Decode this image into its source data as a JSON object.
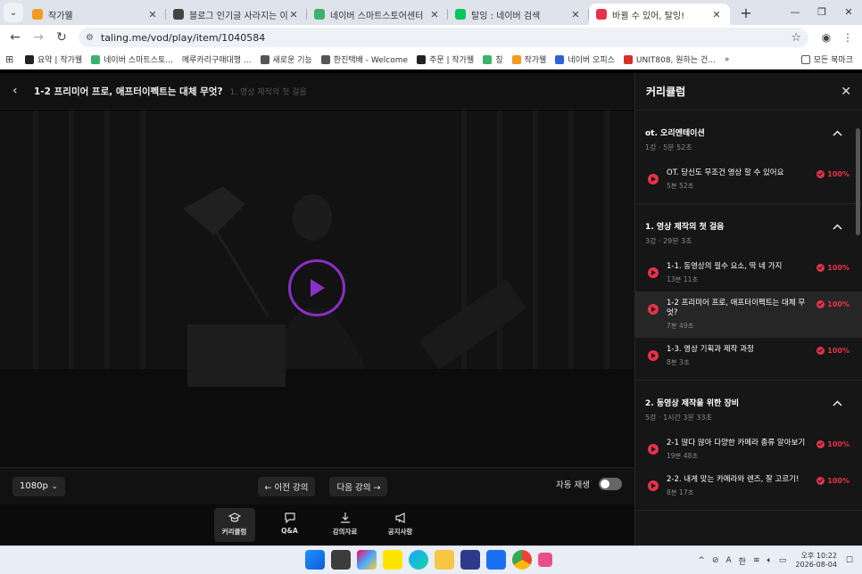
{
  "browser": {
    "tabs": [
      {
        "title": "작가웰",
        "color": "#f39a1f",
        "icon": "flame-icon"
      },
      {
        "title": "블로그 인기글 사라지는 이유",
        "color": "#444444",
        "icon": "openai-icon"
      },
      {
        "title": "네이버 스마트스토어센터",
        "color": "#3bb36c",
        "icon": "smartstore-icon"
      },
      {
        "title": "탈잉 : 네이버 검색",
        "color": "#03c75a",
        "icon": "naver-icon"
      },
      {
        "title": "바뀔 수 있어, 탈잉!",
        "color": "#e8324a",
        "icon": "taling-icon",
        "active": true
      }
    ],
    "url": "taling.me/vod/play/item/1040584",
    "bookmarks": [
      {
        "label": "요약 | 작가웰",
        "color": "#222222"
      },
      {
        "label": "네이버 스마트스토...",
        "color": "#3bb36c"
      },
      {
        "label": "메루카리구매대행 ...",
        "color": "#ffffff"
      },
      {
        "label": "새로운 기능",
        "color": "#555555"
      },
      {
        "label": "한진택배 - Welcome",
        "color": "#555555"
      },
      {
        "label": "주문 | 작가웰",
        "color": "#222222"
      },
      {
        "label": "칭",
        "color": "#3bb36c"
      },
      {
        "label": "작가웰",
        "color": "#f39a1f"
      },
      {
        "label": "네이버 오피스",
        "color": "#2e63d6"
      },
      {
        "label": "UNIT808, 원하는 건...",
        "color": "#d93025"
      }
    ],
    "all_bookmarks": "모든 북마크"
  },
  "player": {
    "title": "1-2 프리미어 프로, 애프터이펙트는 대체 무엇?",
    "section": "1. 영상 제작의 첫 걸음",
    "quality": "1080p",
    "prev_label": "← 이전 강의",
    "next_label": "다음 강의 →",
    "autoplay_label": "자동 재생",
    "nav": [
      {
        "label": "커리큘럼",
        "icon": "graduation-cap-icon",
        "active": true
      },
      {
        "label": "Q&A",
        "icon": "chat-bubble-icon"
      },
      {
        "label": "강의자료",
        "icon": "download-icon"
      },
      {
        "label": "공지사항",
        "icon": "megaphone-icon"
      }
    ]
  },
  "curriculum": {
    "title": "커리큘럼",
    "sections": [
      {
        "name": "ot. 오리엔테이션",
        "meta": "1강 · 5분 52초",
        "lessons": [
          {
            "name": "OT. 당신도 무조건 영상 할 수 있어요",
            "duration": "5분 52초",
            "progress": "100%"
          }
        ]
      },
      {
        "name": "1. 영상 제작의 첫 걸음",
        "meta": "3강 · 29분 3초",
        "lessons": [
          {
            "name": "1-1. 동영상의 필수 요소, 딱 네 가지",
            "duration": "13분 11초",
            "progress": "100%"
          },
          {
            "name": "1-2 프리미어 프로, 애프터이펙트는 대체 무엇?",
            "duration": "7분 49초",
            "progress": "100%",
            "current": true
          },
          {
            "name": "1-3. 영상 기획과 제작 과정",
            "duration": "8분 3초",
            "progress": "100%"
          }
        ]
      },
      {
        "name": "2. 동영상 제작을 위한 장비",
        "meta": "5강 · 1시간 3분 33초",
        "lessons": [
          {
            "name": "2-1 많다 많아 다양한 카메라 종류 알아보기",
            "duration": "19분 48초",
            "progress": "100%"
          },
          {
            "name": "2-2. 내게 맞는 카메라와 렌즈, 잘 고르기!",
            "duration": "8분 17초",
            "progress": "100%"
          }
        ]
      }
    ]
  },
  "taskbar": {
    "ime": "A",
    "lang": "한",
    "time": "오후 10:22",
    "date": "2026-08-04"
  }
}
